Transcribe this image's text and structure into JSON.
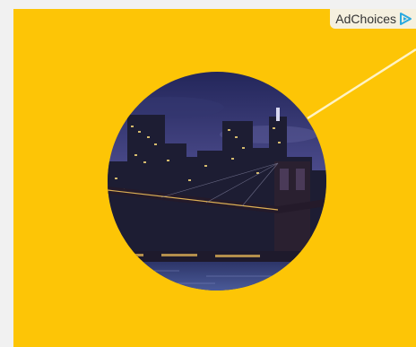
{
  "ad": {
    "adchoices_label": "AdChoices",
    "adchoices_icon": "adchoices-triangle-icon",
    "image_subject": "city-skyline-bridge-night"
  },
  "colors": {
    "panel_background": "#fdc506",
    "connector_line": "#fff3c4",
    "adchoices_icon": "#29a9e0",
    "sky_top": "#2b2e63",
    "water": "#3a4a86"
  }
}
